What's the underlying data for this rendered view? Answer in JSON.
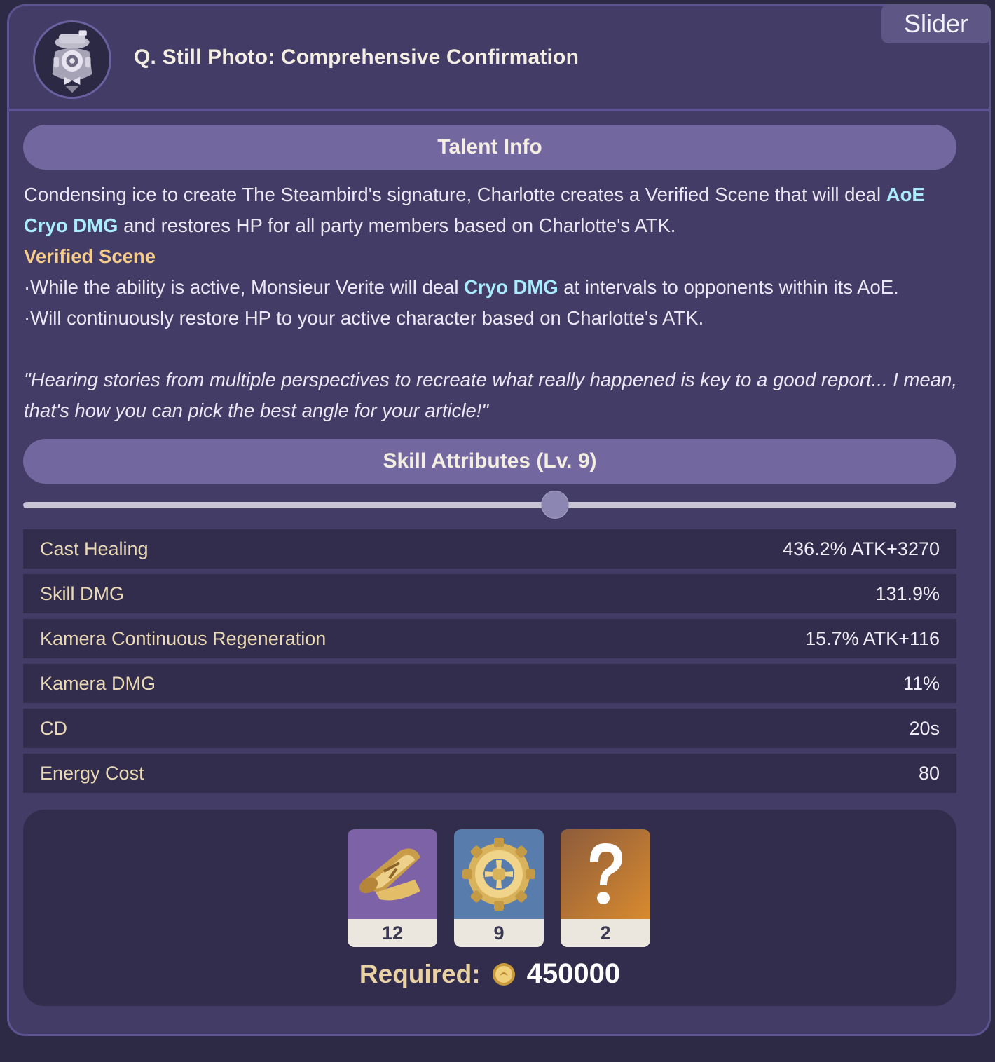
{
  "slider_tag": "Slider",
  "header": {
    "title": "Q. Still Photo: Comprehensive Confirmation",
    "icon": "camera-kamera-icon"
  },
  "talent": {
    "heading": "Talent Info",
    "p1_a": "Condensing ice to create The Steambird's signature, Charlotte creates a Verified Scene that will deal ",
    "p1_hl": "AoE Cryo DMG",
    "p1_b": " and restores HP for all party members based on Charlotte's ATK.",
    "sub_heading": "Verified Scene",
    "b1_a": "·While the ability is active, Monsieur Verite will deal ",
    "b1_hl": "Cryo DMG",
    "b1_b": " at intervals to opponents within its AoE.",
    "b2": "·Will continuously restore HP to your active character based on Charlotte's ATK.",
    "quote": "\"Hearing stories from multiple perspectives to recreate what really happened is key to a good report... I mean, that's how you can pick the best angle for your article!\""
  },
  "skill": {
    "heading": "Skill Attributes (Lv. 9)",
    "slider_fraction": 0.57,
    "rows": [
      {
        "label": "Cast Healing",
        "value": "436.2% ATK+3270"
      },
      {
        "label": "Skill DMG",
        "value": "131.9%"
      },
      {
        "label": "Kamera Continuous Regeneration",
        "value": "15.7% ATK+116"
      },
      {
        "label": "Kamera DMG",
        "value": "11%"
      },
      {
        "label": "CD",
        "value": "20s"
      },
      {
        "label": "Energy Cost",
        "value": "80"
      }
    ]
  },
  "materials": {
    "items": [
      {
        "icon": "talent-book-icon",
        "count": "12",
        "bg": "#7d62a8"
      },
      {
        "icon": "gear-icon",
        "count": "9",
        "bg": "#587cab"
      },
      {
        "icon": "question-mark-icon",
        "count": "2",
        "bg": "#c07a35"
      }
    ],
    "required_label": "Required:",
    "required_amount": "450000",
    "coin_icon": "mora-coin-icon"
  }
}
